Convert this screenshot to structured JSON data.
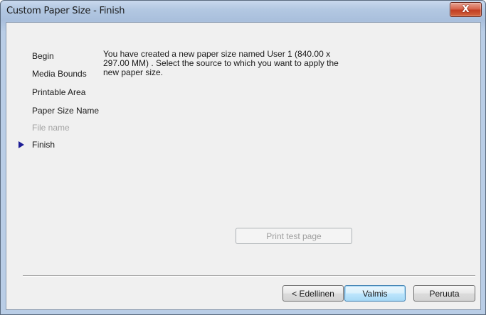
{
  "window": {
    "title": "Custom Paper Size - Finish",
    "close_glyph": "X"
  },
  "nav": {
    "items": [
      {
        "label": "Begin",
        "state": "normal"
      },
      {
        "label": "Media Bounds",
        "state": "normal"
      },
      {
        "label": "Printable Area",
        "state": "normal"
      },
      {
        "label": "Paper Size Name",
        "state": "normal"
      },
      {
        "label": "File name",
        "state": "disabled"
      },
      {
        "label": "Finish",
        "state": "current"
      }
    ],
    "current_indicator_icon": "triangle-right-icon"
  },
  "content": {
    "message_line1": "You have created a new paper size named User 1 (840.00 x",
    "message_line2": "297.00 MM) . Select the source to which you want to apply the",
    "message_line3": "new paper size."
  },
  "buttons": {
    "print_test_page": "Print test page",
    "back": "< Edellinen",
    "finish": "Valmis",
    "cancel": "Peruuta"
  },
  "colors": {
    "arrow": "#1e1e96",
    "close_button": "#c23d22"
  }
}
